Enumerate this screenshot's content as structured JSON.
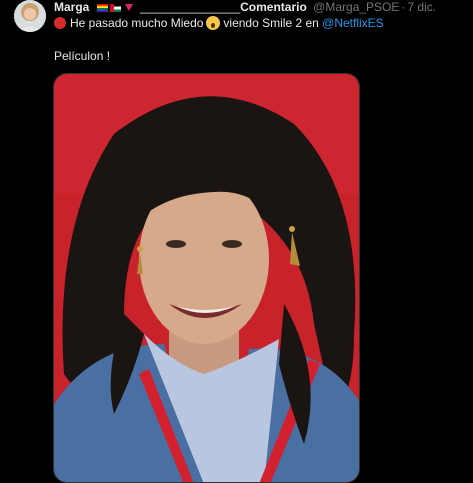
{
  "tweet": {
    "author_name": "Marga",
    "header_separator": "_______________",
    "header_label": "Comentario",
    "handle": "@Marga_PSOE",
    "dot": "·",
    "date": "7 dic.",
    "text_line1_a": "He pasado mucho Miedo",
    "text_line1_b": "viendo Smile 2 en",
    "mention": "@NetflixES",
    "text_line2": "Películon !"
  },
  "colors": {
    "background": "#000000",
    "text": "#e7e9ea",
    "muted": "#71767b",
    "link": "#1d9bf0",
    "photo_backdrop": "#c8222b"
  },
  "icons": {
    "red_circle": "large-red-circle-icon",
    "scream": "face-screaming-in-fear-icon",
    "flags": [
      "rainbow-flag-icon",
      "palestine-flag-icon",
      "red-triangle-icon"
    ]
  }
}
